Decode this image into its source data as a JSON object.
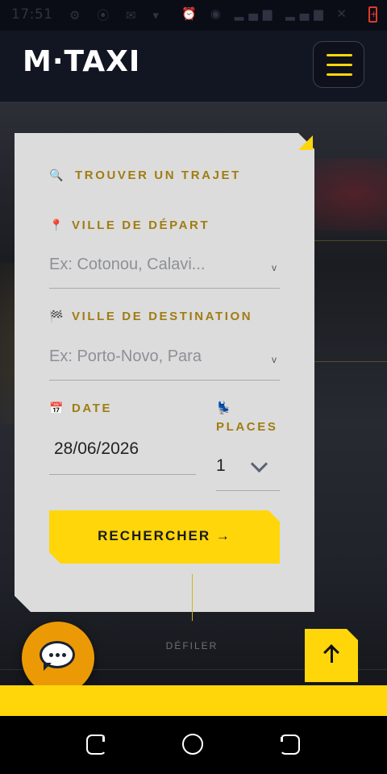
{
  "status_bar": {
    "time": "17:51",
    "left_icons": [
      "settings-icon",
      "signal-app-icon",
      "mail-app-icon",
      "dot-icon"
    ],
    "right_icons": [
      "alarm-icon",
      "wifi-icon",
      "signal-icon",
      "signal-icon",
      "mute-icon"
    ],
    "battery_icon": "battery-charging-icon",
    "battery_color": "#e03a2c"
  },
  "header": {
    "logo": "M·TAXI",
    "menu_icon": "hamburger-icon",
    "accent_color": "#ffd60a"
  },
  "search_form": {
    "title": "TROUVER UN TRAJET",
    "title_icon": "🔍",
    "departure": {
      "label": "VILLE DE DÉPART",
      "icon": "📍",
      "placeholder": "Ex: Cotonou, Calavi...",
      "caret": "v"
    },
    "destination": {
      "label": "VILLE DE DESTINATION",
      "icon": "🏁",
      "placeholder": "Ex: Porto-Novo, Para",
      "caret": "v"
    },
    "date": {
      "label": "DATE",
      "icon": "📅",
      "value": "28/06/2026"
    },
    "places": {
      "label": "PLACES",
      "icon": "💺",
      "value": "1"
    },
    "search_button": "RECHERCHER →"
  },
  "scroll_hint": "DÉFILER",
  "chat_button_icon": "chat-bubble-icon",
  "back_to_top_icon": "arrow-up-icon",
  "nav_bar": {
    "icons": [
      "recent-apps-icon",
      "home-icon",
      "back-icon"
    ]
  }
}
